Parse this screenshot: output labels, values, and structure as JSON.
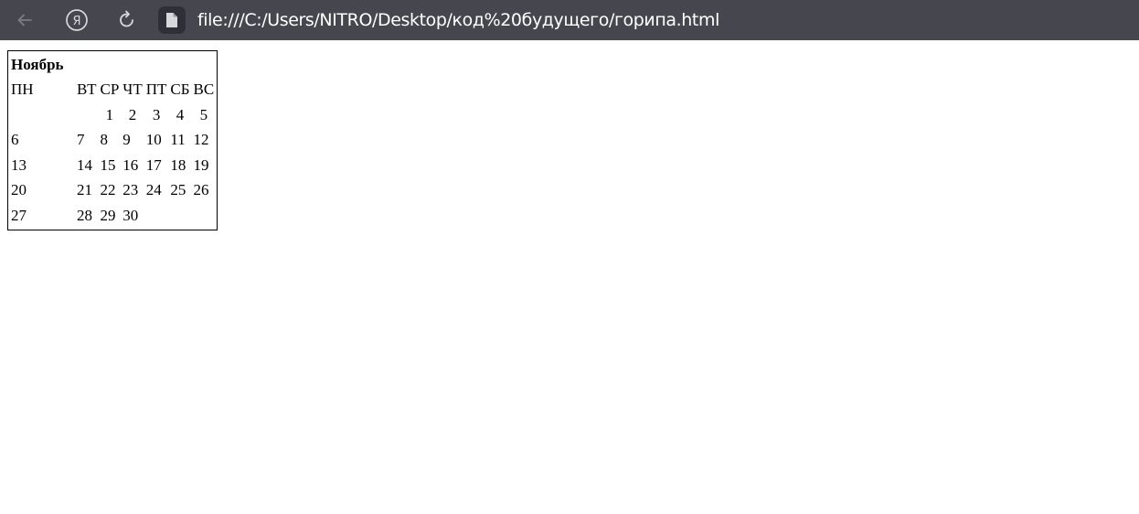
{
  "browser": {
    "url": "file:///C:/Users/NITRO/Desktop/код%20будущего/горипа.html",
    "yandex_logo": "Я"
  },
  "calendar": {
    "month": "Ноябрь",
    "weekdays": [
      "ПН",
      "ВТ",
      "СР",
      "ЧТ",
      "ПТ",
      "СБ",
      "ВС"
    ],
    "weeks": [
      [
        "",
        "",
        "1",
        "2",
        "3",
        "4",
        "5"
      ],
      [
        "6",
        "7",
        "8",
        "9",
        "10",
        "11",
        "12"
      ],
      [
        "13",
        "14",
        "15",
        "16",
        "17",
        "18",
        "19"
      ],
      [
        "20",
        "21",
        "22",
        "23",
        "24",
        "25",
        "26"
      ],
      [
        "27",
        "28",
        "29",
        "30",
        "",
        "",
        ""
      ]
    ]
  }
}
